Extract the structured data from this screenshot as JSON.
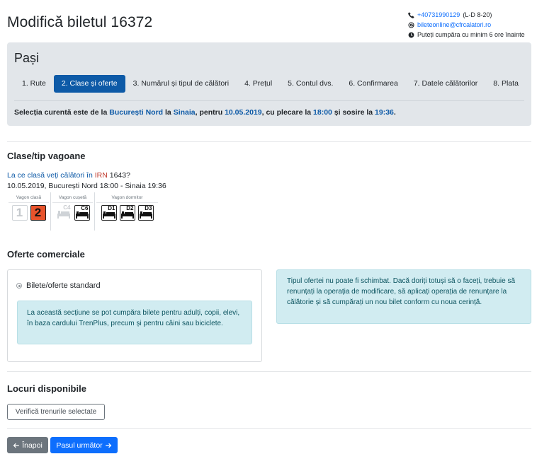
{
  "header": {
    "title": "Modifică biletul 16372",
    "phone": "+40731990129",
    "phone_hours": "(L-D 8-20)",
    "email": "bileteonline@cfrcalatori.ro",
    "notice": "Puteți cumpăra cu minim 6 ore înainte"
  },
  "steps": {
    "title": "Pași",
    "items": [
      {
        "label": "1. Rute"
      },
      {
        "label": "2. Clase și oferte"
      },
      {
        "label": "3. Numărul și tipul de călători"
      },
      {
        "label": "4. Prețul"
      },
      {
        "label": "5. Contul dvs."
      },
      {
        "label": "6. Confirmarea"
      },
      {
        "label": "7. Datele călătorilor"
      },
      {
        "label": "8. Plata"
      }
    ],
    "active_index": 1,
    "selection": {
      "prefix": "Selecția curentă este de la",
      "from": "București Nord",
      "la1": "la",
      "to": "Sinaia",
      "pentru": ", pentru",
      "date": "10.05.2019",
      "plecare": ", cu plecare la",
      "depart": "18:00",
      "sosire": "și sosire la",
      "arrive": "19:36",
      "end": "."
    }
  },
  "classes": {
    "title": "Clase/tip vagoane",
    "question": "La ce clasă veți călători în",
    "train_type": "IRN",
    "train_number": "1643?",
    "info": "10.05.2019, București Nord 18:00 - Sinaia 19:36",
    "groups": [
      {
        "label": "Vagon clasă",
        "items": [
          {
            "code": "1",
            "state": "disabled"
          },
          {
            "code": "2",
            "state": "selected"
          }
        ]
      },
      {
        "label": "Vagon cușetă",
        "items": [
          {
            "code": "C4",
            "state": "disabled"
          },
          {
            "code": "C6",
            "state": "available"
          }
        ]
      },
      {
        "label": "Vagon dormitor",
        "items": [
          {
            "code": "D1",
            "state": "available"
          },
          {
            "code": "D2",
            "state": "available"
          },
          {
            "code": "D3",
            "state": "available"
          }
        ]
      }
    ]
  },
  "offers": {
    "title": "Oferte comerciale",
    "option_label": "Bilete/oferte standard",
    "option_description": "La această secțiune se pot cumpăra bilete pentru adulți, copii, elevi, în baza cardului TrenPlus, precum și pentru câini sau biciclete.",
    "notice": "Tipul ofertei nu poate fi schimbat. Dacă doriți totuși să o faceți, trebuie să renunțați la operația de modificare, să aplicați operația de renunțare la călătorie și să cumpărați un nou bilet conform cu noua cerință."
  },
  "seats": {
    "title": "Locuri disponibile",
    "check_button": "Verifică trenurile selectate"
  },
  "footer": {
    "back_label": "Înapoi",
    "next_label": "Pasul următor"
  },
  "colors": {
    "primary": "#0d6efd",
    "active_step": "#0d5aa7",
    "class2_bg": "#e8532b",
    "info_bg": "#d1ecf1",
    "info_text": "#0c5460"
  }
}
